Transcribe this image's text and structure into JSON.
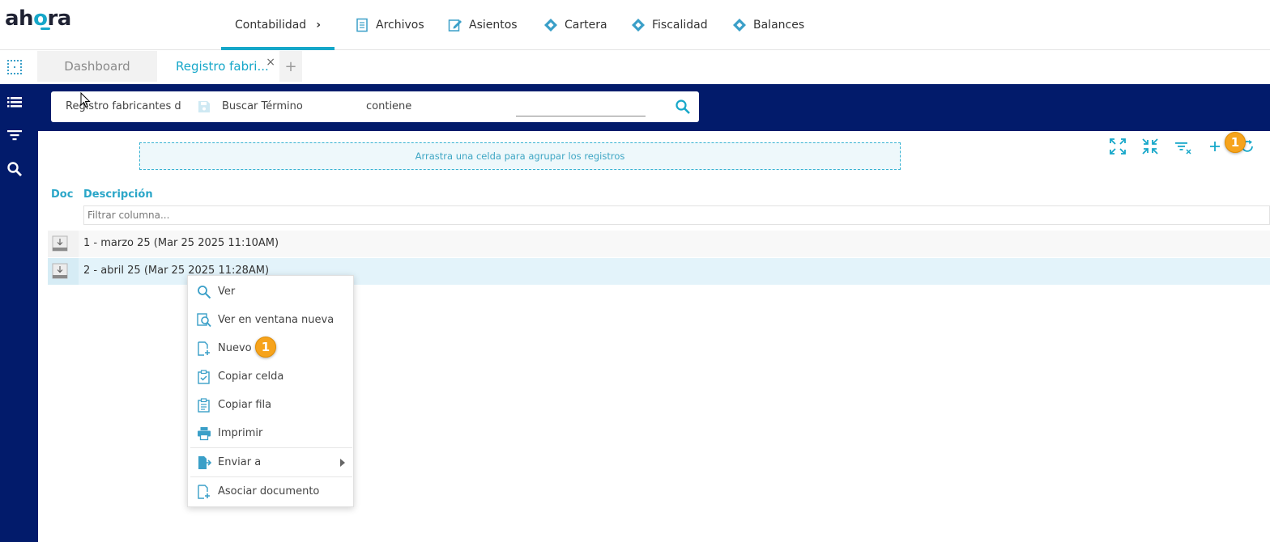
{
  "brand": {
    "logo_pre": "ah",
    "logo_o": "o",
    "logo_post": "ra",
    "accent": "#16a7c9",
    "navy": "#021b6b"
  },
  "nav": {
    "items": [
      {
        "label": "Contabilidad",
        "icon": "chevron-right-icon",
        "active": true
      },
      {
        "label": "Archivos",
        "icon": "document-icon"
      },
      {
        "label": "Asientos",
        "icon": "edit-icon"
      },
      {
        "label": "Cartera",
        "icon": "diamond-icon"
      },
      {
        "label": "Fiscalidad",
        "icon": "diamond-icon"
      },
      {
        "label": "Balances",
        "icon": "diamond-icon"
      }
    ]
  },
  "tabs": {
    "dashboard": "Dashboard",
    "registro": "Registro fabri...",
    "close": "×",
    "add": "+"
  },
  "search": {
    "entity": "Registro fabricantes d",
    "term_label": "Buscar Término",
    "operator": "contiene",
    "value": ""
  },
  "grid": {
    "group_hint": "Arrastra una celda para agrupar los registros",
    "columns": {
      "doc": "Doc",
      "descripcion": "Descripción"
    },
    "filter_placeholder": "Filtrar columna...",
    "rows": [
      {
        "descripcion": "1 - marzo 25 (Mar 25 2025 11:10AM)"
      },
      {
        "descripcion": "2 - abril 25 (Mar 25 2025 11:28AM)",
        "selected": true
      }
    ]
  },
  "badges": {
    "toolbar": "1",
    "menu": "1"
  },
  "badge_color": "#f6a31c",
  "context_menu": {
    "items": [
      {
        "label": "Ver",
        "icon": "search-icon"
      },
      {
        "label": "Ver en ventana nueva",
        "icon": "search-window-icon"
      },
      {
        "label": "Nuevo",
        "icon": "new-document-icon"
      },
      {
        "label": "Copiar celda",
        "icon": "clipboard-check-icon"
      },
      {
        "label": "Copiar fila",
        "icon": "clipboard-icon"
      },
      {
        "label": "Imprimir",
        "icon": "printer-icon"
      },
      {
        "label": "Enviar a",
        "icon": "send-icon",
        "submenu": true
      },
      {
        "label": "Asociar documento",
        "icon": "attach-document-icon"
      }
    ]
  }
}
